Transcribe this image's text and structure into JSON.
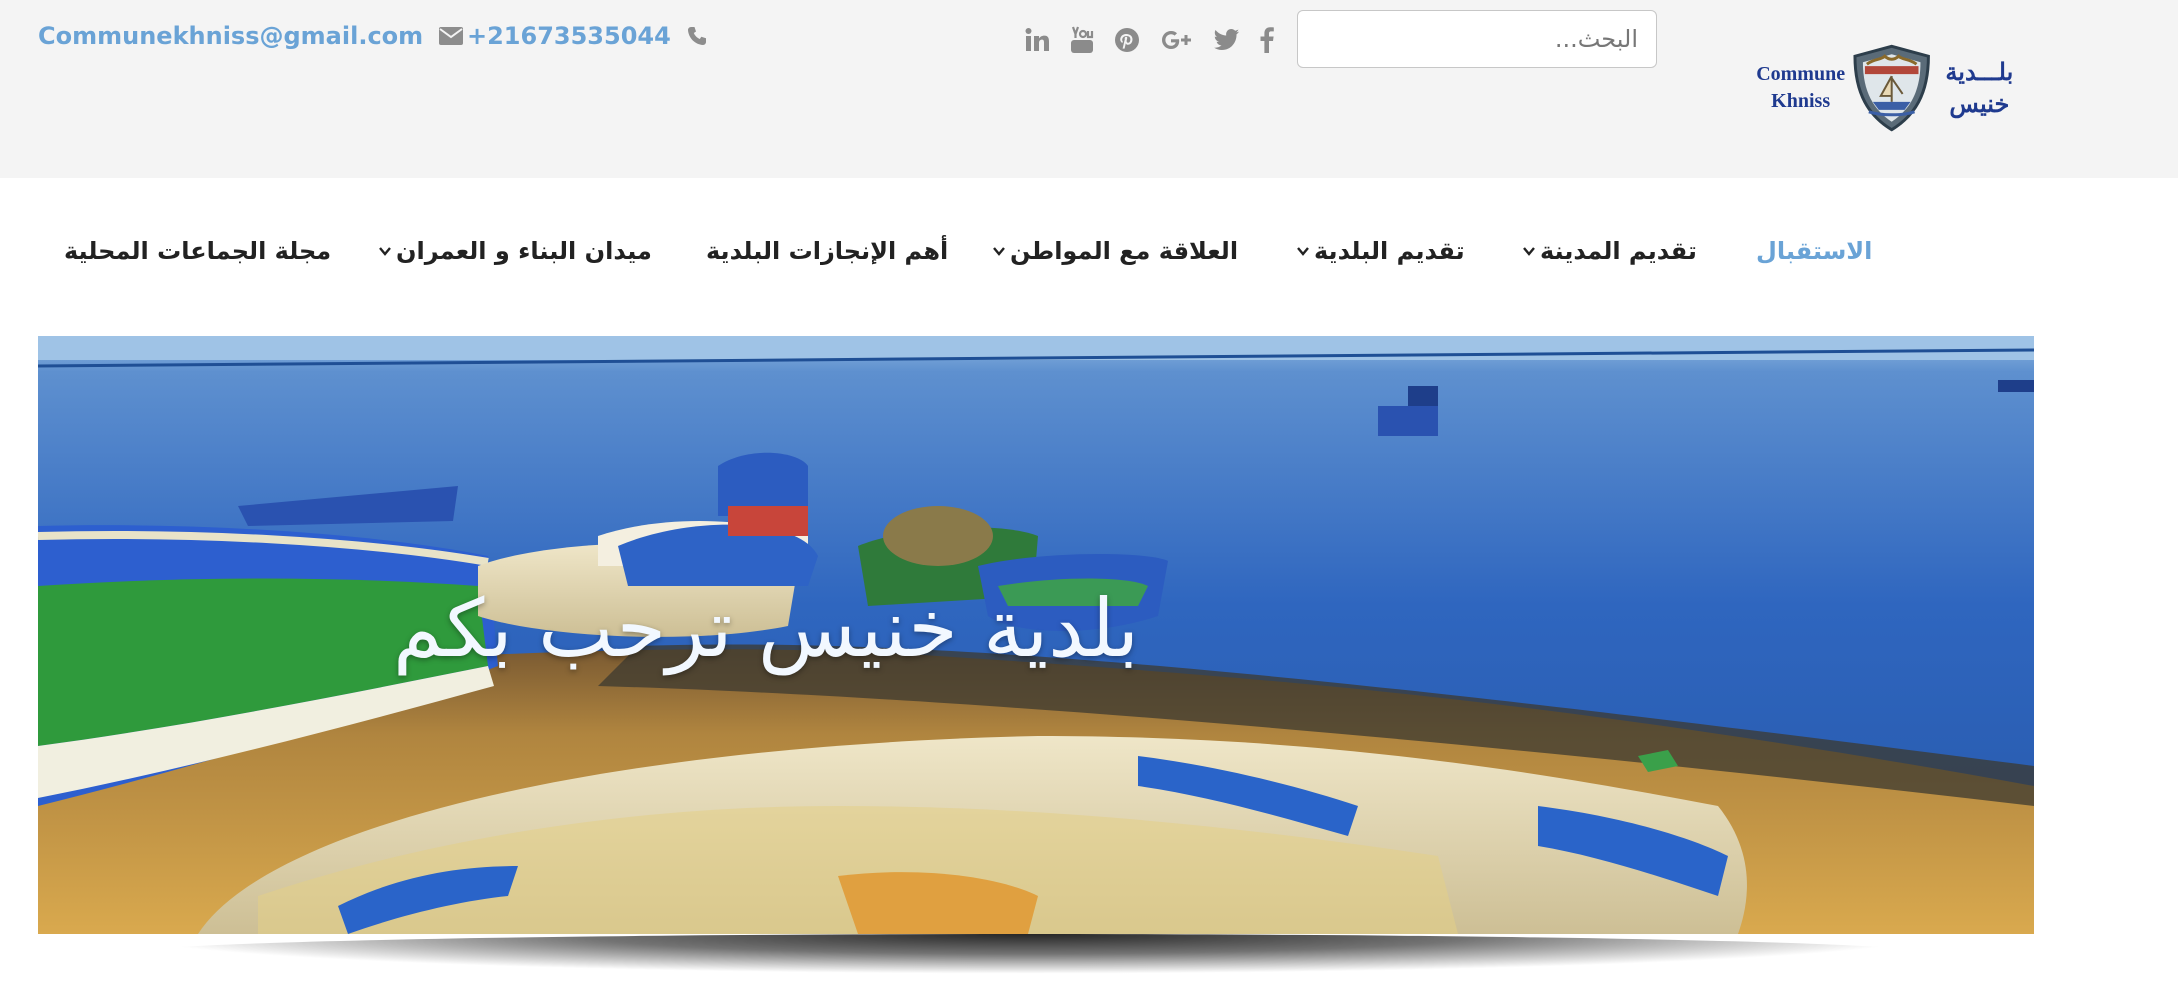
{
  "header": {
    "email": "Communekhniss@gmail.com",
    "phone": "+21673535044",
    "search_placeholder": "البحث...",
    "logo": {
      "latin_line1": "Commune",
      "latin_line2": "Khniss",
      "arabic_line1": "بلـــدية",
      "arabic_line2": "خنيس"
    },
    "socials": [
      "linkedin-icon",
      "youtube-icon",
      "pinterest-icon",
      "google-plus-icon",
      "twitter-icon",
      "facebook-icon"
    ]
  },
  "nav": {
    "items": [
      {
        "label": "الاستقبال",
        "active": true,
        "dropdown": false
      },
      {
        "label": "تقديم المدينة",
        "active": false,
        "dropdown": true
      },
      {
        "label": "تقديم البلدية",
        "active": false,
        "dropdown": true
      },
      {
        "label": "العلاقة مع المواطن",
        "active": false,
        "dropdown": true
      },
      {
        "label": "أهم الإنجازات البلدية",
        "active": false,
        "dropdown": false
      },
      {
        "label": "ميدان البناء و العمران",
        "active": false,
        "dropdown": true
      },
      {
        "label": "مجلة الجماعات المحلية",
        "active": false,
        "dropdown": false
      }
    ]
  },
  "hero": {
    "title": "بلدية خنيس ترحب بكم"
  },
  "colors": {
    "accent": "#6aa3d6",
    "topbar_bg": "#f4f4f4",
    "icon_gray": "#8b8b8b",
    "logo_blue": "#1f3a8f"
  }
}
